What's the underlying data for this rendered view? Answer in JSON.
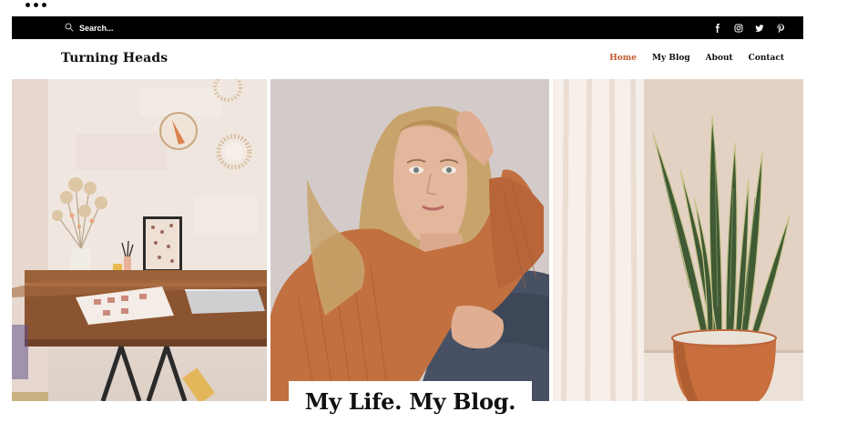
{
  "window": {
    "menu_icon": "more-dots-icon"
  },
  "topbar": {
    "search_placeholder": "Search...",
    "search_icon": "search-icon",
    "social": [
      "facebook-icon",
      "instagram-icon",
      "twitter-icon",
      "pinterest-icon"
    ]
  },
  "header": {
    "site_title": "Turning Heads",
    "nav": [
      {
        "label": "Home",
        "active": true
      },
      {
        "label": "My Blog",
        "active": false
      },
      {
        "label": "About",
        "active": false
      },
      {
        "label": "Contact",
        "active": false
      }
    ]
  },
  "hero": {
    "title": "My Life. My Blog."
  },
  "colors": {
    "accent": "#c3582b",
    "topbar": "#000000",
    "text": "#111111",
    "background": "#ffffff"
  }
}
